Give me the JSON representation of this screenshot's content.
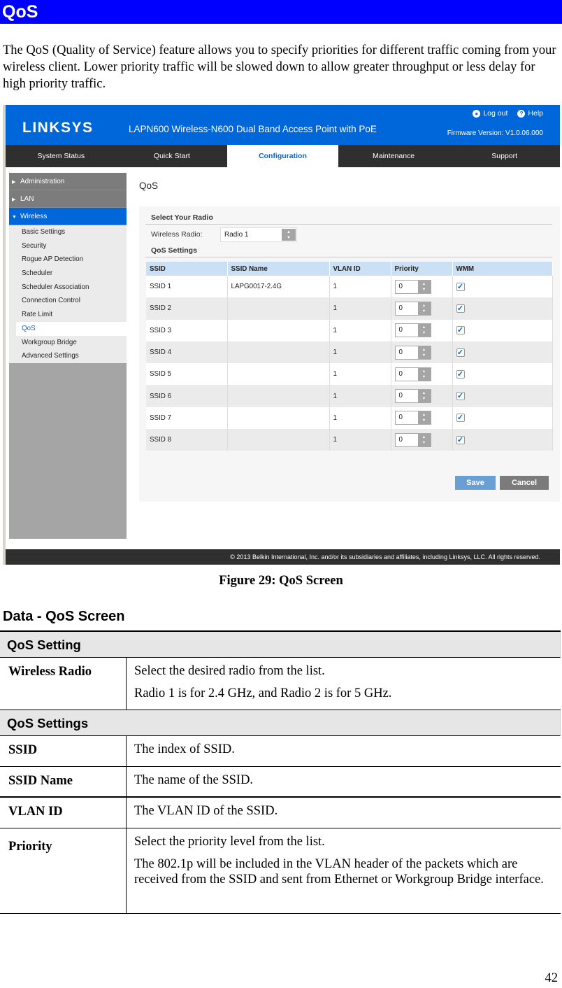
{
  "heading": "QoS",
  "intro": "The QoS (Quality of Service) feature allows you to specify priorities for different traffic coming from your wireless client. Lower priority traffic will be slowed down to allow greater throughput or less delay for high priority traffic.",
  "screenshot": {
    "logo": "LINKSYS",
    "product": "LAPN600 Wireless-N600 Dual Band Access Point with PoE",
    "links": {
      "logout": "Log out",
      "help": "Help"
    },
    "firmware": "Firmware Version: V1.0.06.000",
    "nav": [
      {
        "label": "System Status"
      },
      {
        "label": "Quick Start"
      },
      {
        "label": "Configuration",
        "active": true
      },
      {
        "label": "Maintenance"
      },
      {
        "label": "Support"
      }
    ],
    "sidebar": {
      "groups": [
        {
          "label": "Administration"
        },
        {
          "label": "LAN"
        },
        {
          "label": "Wireless"
        }
      ],
      "items": [
        {
          "label": "Basic Settings"
        },
        {
          "label": "Security"
        },
        {
          "label": "Rogue AP Detection"
        },
        {
          "label": "Scheduler"
        },
        {
          "label": "Scheduler Association"
        },
        {
          "label": "Connection Control"
        },
        {
          "label": "Rate Limit"
        },
        {
          "label": "QoS",
          "active": true
        },
        {
          "label": "Workgroup Bridge"
        },
        {
          "label": "Advanced Settings"
        }
      ]
    },
    "content_title": "QoS",
    "select_radio_title": "Select Your Radio",
    "wireless_radio_label": "Wireless Radio:",
    "wireless_radio_value": "Radio 1",
    "qos_settings_title": "QoS Settings",
    "table": {
      "headers": [
        "SSID",
        "SSID Name",
        "VLAN ID",
        "Priority",
        "WMM"
      ],
      "rows": [
        {
          "ssid": "SSID 1",
          "name": "LAPG0017-2.4G",
          "vlan": "1",
          "priority": "0",
          "wmm": true
        },
        {
          "ssid": "SSID 2",
          "name": "",
          "vlan": "1",
          "priority": "0",
          "wmm": true
        },
        {
          "ssid": "SSID 3",
          "name": "",
          "vlan": "1",
          "priority": "0",
          "wmm": true
        },
        {
          "ssid": "SSID 4",
          "name": "",
          "vlan": "1",
          "priority": "0",
          "wmm": true
        },
        {
          "ssid": "SSID 5",
          "name": "",
          "vlan": "1",
          "priority": "0",
          "wmm": true
        },
        {
          "ssid": "SSID 6",
          "name": "",
          "vlan": "1",
          "priority": "0",
          "wmm": true
        },
        {
          "ssid": "SSID 7",
          "name": "",
          "vlan": "1",
          "priority": "0",
          "wmm": true
        },
        {
          "ssid": "SSID 8",
          "name": "",
          "vlan": "1",
          "priority": "0",
          "wmm": true
        }
      ]
    },
    "save": "Save",
    "cancel": "Cancel",
    "footer": "© 2013 Belkin International, Inc. and/or its subsidiaries and affiliates, including Linksys, LLC. All rights reserved.",
    "colors": {
      "brand_blue": "#0067db",
      "nav_dark": "#2f2f2f",
      "save": "#6a9fd4",
      "cancel": "#7b7b7b"
    }
  },
  "caption": "Figure 29: QoS Screen",
  "data_heading": "Data - QoS Screen",
  "data_table": {
    "section1": "QoS Setting",
    "wireless_radio": {
      "label": "Wireless Radio",
      "desc": [
        "Select the desired radio from the list.",
        "Radio 1 is for 2.4 GHz, and Radio 2 is for 5 GHz."
      ]
    },
    "section2": "QoS Settings",
    "ssid": {
      "label": "SSID",
      "desc": "The index of SSID."
    },
    "ssid_name": {
      "label": "SSID Name",
      "desc": "The name of the SSID."
    },
    "vlan_id": {
      "label": "VLAN ID",
      "desc": "The VLAN ID of the SSID."
    },
    "priority": {
      "label": "Priority",
      "desc": [
        "Select the priority level from the list.",
        "The 802.1p will be included in the VLAN header of the packets which are received from the SSID and sent from Ethernet or Workgroup Bridge interface."
      ]
    }
  },
  "page_number": "42"
}
